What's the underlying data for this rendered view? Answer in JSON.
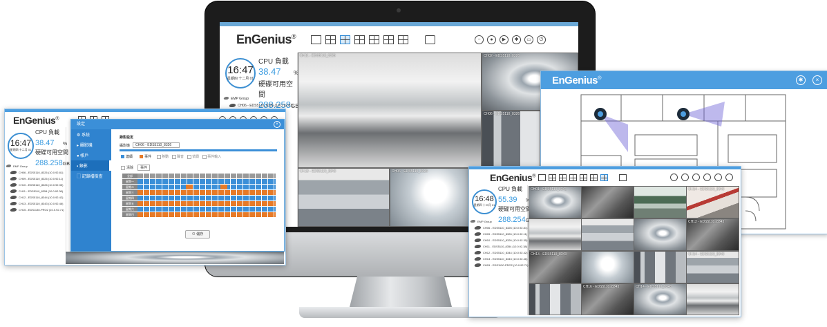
{
  "brand": {
    "logo_text": "EnGenius",
    "logo_reg": "®",
    "accent_color": "#3a9be0",
    "header_blue": "#4d9ee0"
  },
  "monitor": {
    "clock_time": "16:47",
    "clock_date": "星期四 十二月 01",
    "cpu_label": "CPU 負載",
    "cpu_value": "38.47",
    "cpu_unit": "%",
    "disk_label": "硬碟可用空間",
    "disk_value": "288.258",
    "disk_unit": "GB",
    "group_label": "EMP Group",
    "tree_items": [
      "CH06 - EDS5110_8326 (10.0.92.81)"
    ],
    "cameras": [
      {
        "label": "CH11 - EDS5110_8326"
      },
      {
        "label": "CH02 - EDS5110_8326"
      },
      {
        "label": "CH06 - EDS5110_8326"
      },
      {
        "label": "CH13 - EDS5110_8343"
      },
      {
        "label": "CH06 - EDS5110_8326"
      },
      {
        "label": ""
      }
    ]
  },
  "settings_window": {
    "clock_time": "16:47",
    "clock_date": "星期四 十二月 01",
    "cpu_label": "CPU 負載",
    "cpu_value": "38.47",
    "cpu_unit": "%",
    "disk_label": "硬碟可用空間",
    "disk_value": "288.258",
    "disk_unit": "GB",
    "group_label": "EMP Group",
    "tree_items": [
      "CH06 - EDS5110_8326 (10.0.92.81)",
      "CH09 - EDS5110_8326 (10.0.92.11)",
      "CH10 - EDS5110_8326 (10.0.92.35)",
      "CH11 - EDS5110_8354 (10.0.92.38)",
      "CH12 - EDS5110_8344 (10.0.92.42)",
      "CH13 - EDS5110_8343 (10.0.92.46)",
      "CH15 - EDS1130-PRO2 (10.0.92.71)"
    ],
    "dialog": {
      "title": "設定",
      "nav": [
        "系統",
        "攝影機",
        "帳戶",
        "錄影",
        "記錄檔檢查"
      ],
      "section": "錄影設定",
      "channel_label": "攝影機",
      "channel_value": "CH06 - EDS5110_8326",
      "mode_regular": "連續",
      "mode_event": "事件",
      "opt1": "移動",
      "opt2": "聲音",
      "opt3": "偵測",
      "opt4": "事件輸入",
      "clear_label": "清除",
      "clear_value": "事件",
      "all_label": "全部",
      "days": [
        "星期一",
        "星期二",
        "星期三",
        "星期四",
        "星期五",
        "星期六",
        "星期日"
      ],
      "save_label": "儲存"
    }
  },
  "floorplan_window": {
    "logo_text": "EnGenius",
    "logo_reg": "®",
    "icons": [
      "gear-icon",
      "close-icon"
    ]
  },
  "grid_window": {
    "clock_time": "16:48",
    "clock_date": "星期四 十二月 01",
    "cpu_label": "CPU 負載",
    "cpu_value": "55.39",
    "cpu_unit": "%",
    "disk_label": "硬碟可用空間",
    "disk_value": "288.254",
    "disk_unit": "GB",
    "group_label": "EMP Group",
    "tree_items": [
      "CH06 - EDS5110_8326 (10.0.92.81)",
      "CH09 - EDS5110_8326 (10.0.92.11)",
      "CH10 - EDS5110_8326 (10.0.92.35)",
      "CH11 - EDS5110_8354 (10.0.92.38)",
      "CH12 - EDS5110_8344 (10.0.92.42)",
      "CH13 - EDS5110_8343 (10.0.92.46)",
      "CH15 - EDS1130-PRO2 (10.0.92.71)"
    ],
    "tiles": [
      "CH01 - EDS5110_8343",
      "",
      "",
      "CH14 - EDS5110_8343",
      "",
      "",
      "",
      "CH12 - EDS5110_8343",
      "CH13 - EDS5110_8343",
      "",
      "",
      "CH14 - EDS5110_8343",
      "",
      "CH16 - EDS5110_8343",
      "CH14 - EDS5110_8343",
      ""
    ]
  }
}
